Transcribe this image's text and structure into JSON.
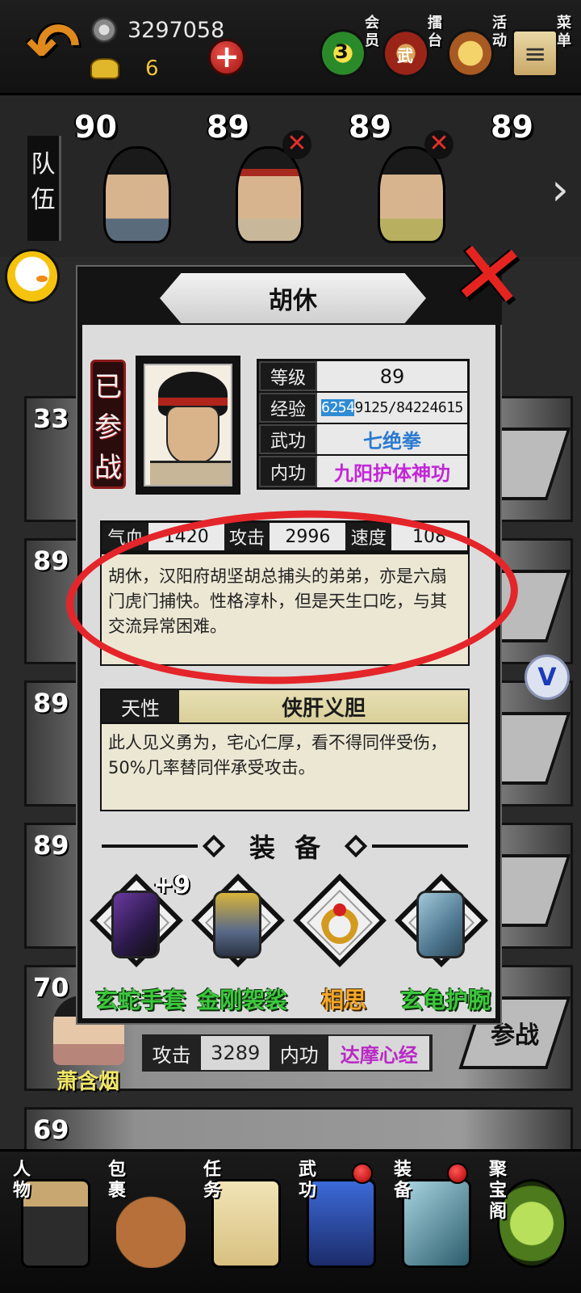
{
  "top": {
    "coins": "3297058",
    "ingots": "6",
    "icons": [
      {
        "label": "会员",
        "badge": "3"
      },
      {
        "label": "擂台",
        "badge": "武"
      },
      {
        "label": "活动"
      },
      {
        "label": "菜单"
      }
    ]
  },
  "team": {
    "tab_label": "队伍",
    "heroes": [
      {
        "level": "90"
      },
      {
        "level": "89"
      },
      {
        "level": "89"
      },
      {
        "level": "89"
      }
    ]
  },
  "background_list": {
    "rows": [
      {
        "level": "33"
      },
      {
        "level": "89"
      },
      {
        "level": "89"
      },
      {
        "level": "89"
      },
      {
        "level": "70"
      },
      {
        "level": "69"
      }
    ],
    "bottom_card": {
      "attack_label": "攻击",
      "attack_value": "3289",
      "inner_label": "内功",
      "inner_skill": "达摩心经",
      "name": "萧含烟",
      "join_button": "参战"
    }
  },
  "modal": {
    "name": "胡休",
    "status": "已参战",
    "stats": {
      "level_label": "等级",
      "level_value": "89",
      "exp_label": "经验",
      "exp_highlight": "6254",
      "exp_rest": "9125/84224615",
      "martial_label": "武功",
      "martial_value": "七绝拳",
      "inner_label": "内功",
      "inner_value": "九阳护体神功"
    },
    "attributes": [
      {
        "label": "气血",
        "value": "1420"
      },
      {
        "label": "攻击",
        "value": "2996"
      },
      {
        "label": "速度",
        "value": "108"
      }
    ],
    "description": "胡休，汉阳府胡坚胡总捕头的弟弟，亦是六扇门虎门捕快。性格淳朴，但是天生口吃，与其交流异常困难。",
    "trait": {
      "label": "天性",
      "name": "侠肝义胆",
      "description": "此人见义勇为，宅心仁厚，看不得同伴受伤，50%几率替同伴承受攻击。"
    },
    "equipment": {
      "title": "装备",
      "items": [
        {
          "name": "玄蛇手套",
          "plus": "+9",
          "color": "#3cc73c"
        },
        {
          "name": "金刚袈裟",
          "color": "#3cc73c"
        },
        {
          "name": "相思",
          "color": "#f4a82a"
        },
        {
          "name": "玄龟护腕",
          "color": "#3cc73c"
        }
      ]
    }
  },
  "nav": {
    "items": [
      {
        "label": "人物"
      },
      {
        "label": "包裹"
      },
      {
        "label": "任务"
      },
      {
        "label": "武功"
      },
      {
        "label": "装备"
      },
      {
        "label": "聚宝阁"
      }
    ]
  }
}
